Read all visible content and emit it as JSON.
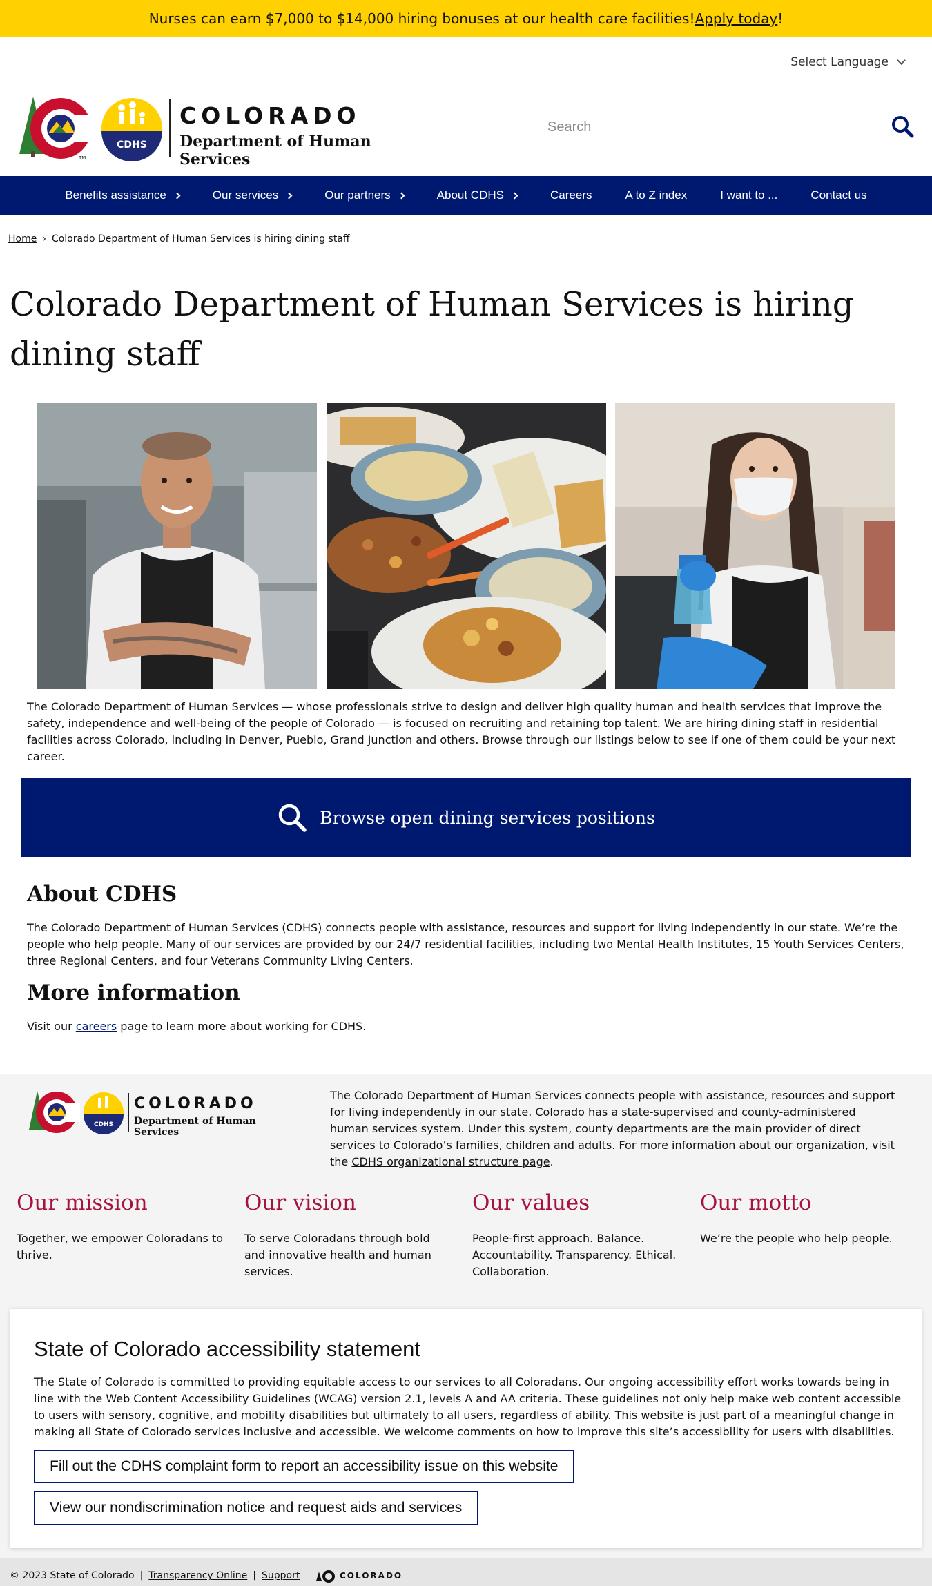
{
  "alert": {
    "text": "Nurses can earn $7,000 to $14,000 hiring bonuses at our health care facilities! ",
    "link": "Apply today",
    "suffix": "!"
  },
  "language": {
    "label": "Select Language"
  },
  "logo": {
    "wordmark": "COLORADO",
    "department": "Department of Human Services",
    "badge": "CDHS",
    "tm": "TM"
  },
  "search": {
    "placeholder": "Search"
  },
  "nav": {
    "items": [
      {
        "label": "Benefits assistance",
        "has_submenu": true
      },
      {
        "label": "Our services",
        "has_submenu": true
      },
      {
        "label": "Our partners",
        "has_submenu": true
      },
      {
        "label": "About CDHS",
        "has_submenu": true
      },
      {
        "label": "Careers",
        "has_submenu": false
      },
      {
        "label": "A to Z index",
        "has_submenu": false
      },
      {
        "label": "I want to ...",
        "has_submenu": false
      },
      {
        "label": "Contact us",
        "has_submenu": false
      }
    ]
  },
  "breadcrumb": {
    "home": "Home",
    "separator": "›",
    "current": "Colorado Department of Human Services is hiring dining staff"
  },
  "page": {
    "title": "Colorado Department of Human Services is hiring dining staff",
    "intro": "The Colorado Department of Human Services — whose professionals strive to design and deliver high quality human and health services that improve the safety, independence and well-being of the people of Colorado — is focused on recruiting and retaining top talent. We are hiring dining staff in residential facilities across Colorado, including in Denver, Pueblo, Grand Junction and others. Browse through our listings below to see if one of them could be your next career.",
    "browse_label": "Browse open dining services positions",
    "about_heading": "About CDHS",
    "about_text": "The Colorado Department of Human Services (CDHS) connects people with assistance, resources and support for living independently in our state. We’re the people who help people. Many of our services are provided by our 24/7 residential facilities, including two Mental Health Institutes, 15 Youth Services Centers, three Regional Centers, and four Veterans Community Living Centers.",
    "more_heading": "More information",
    "more_prefix": "Visit our ",
    "more_link": "careers",
    "more_suffix": " page to learn more about working for CDHS."
  },
  "footer": {
    "about_text": "The Colorado Department of Human Services connects people with assistance, resources and support for living independently in our state. Colorado has a state-supervised and county-administered human services system. Under this system, county departments are the main provider of direct services to Colorado’s families, children and adults. For more information about our organization, visit the ",
    "about_link": "CDHS organizational structure page",
    "about_suffix": ".",
    "columns": [
      {
        "title": "Our mission",
        "text": "Together, we empower Coloradans to thrive."
      },
      {
        "title": "Our vision",
        "text": "To serve Coloradans through bold and innovative health and human services."
      },
      {
        "title": "Our values",
        "text": "People-first approach. Balance. Accountability. Transparency. Ethical. Collaboration."
      },
      {
        "title": "Our motto",
        "text": "We’re the people who help people."
      }
    ],
    "accessibility": {
      "title": "State of Colorado accessibility statement",
      "text": "The State of Colorado is committed to providing equitable access to our services to all Coloradans. Our ongoing accessibility effort works towards being in line with the Web Content Accessibility Guidelines (WCAG) version 2.1, levels A and AA criteria. These guidelines not only help make web content accessible to users with sensory, cognitive, and mobility disabilities but ultimately to all users, regardless of ability. This website is just part of a meaningful change in making all State of Colorado services inclusive and accessible. We welcome comments on how to improve this site’s accessibility for users with disabilities.",
      "button1": "Fill out the CDHS complaint form to report an accessibility issue on this website",
      "button2": "View our nondiscrimination notice and request aids and services"
    },
    "copyright": "© 2023 State of Colorado",
    "sep": "|",
    "transparency": "Transparency Online",
    "support": "Support",
    "state_wordmark": "COLORADO"
  },
  "colors": {
    "navy": "#001970",
    "gold": "#ffd100",
    "crimson": "#a8123e",
    "footer_bg": "#f4f4f4"
  }
}
